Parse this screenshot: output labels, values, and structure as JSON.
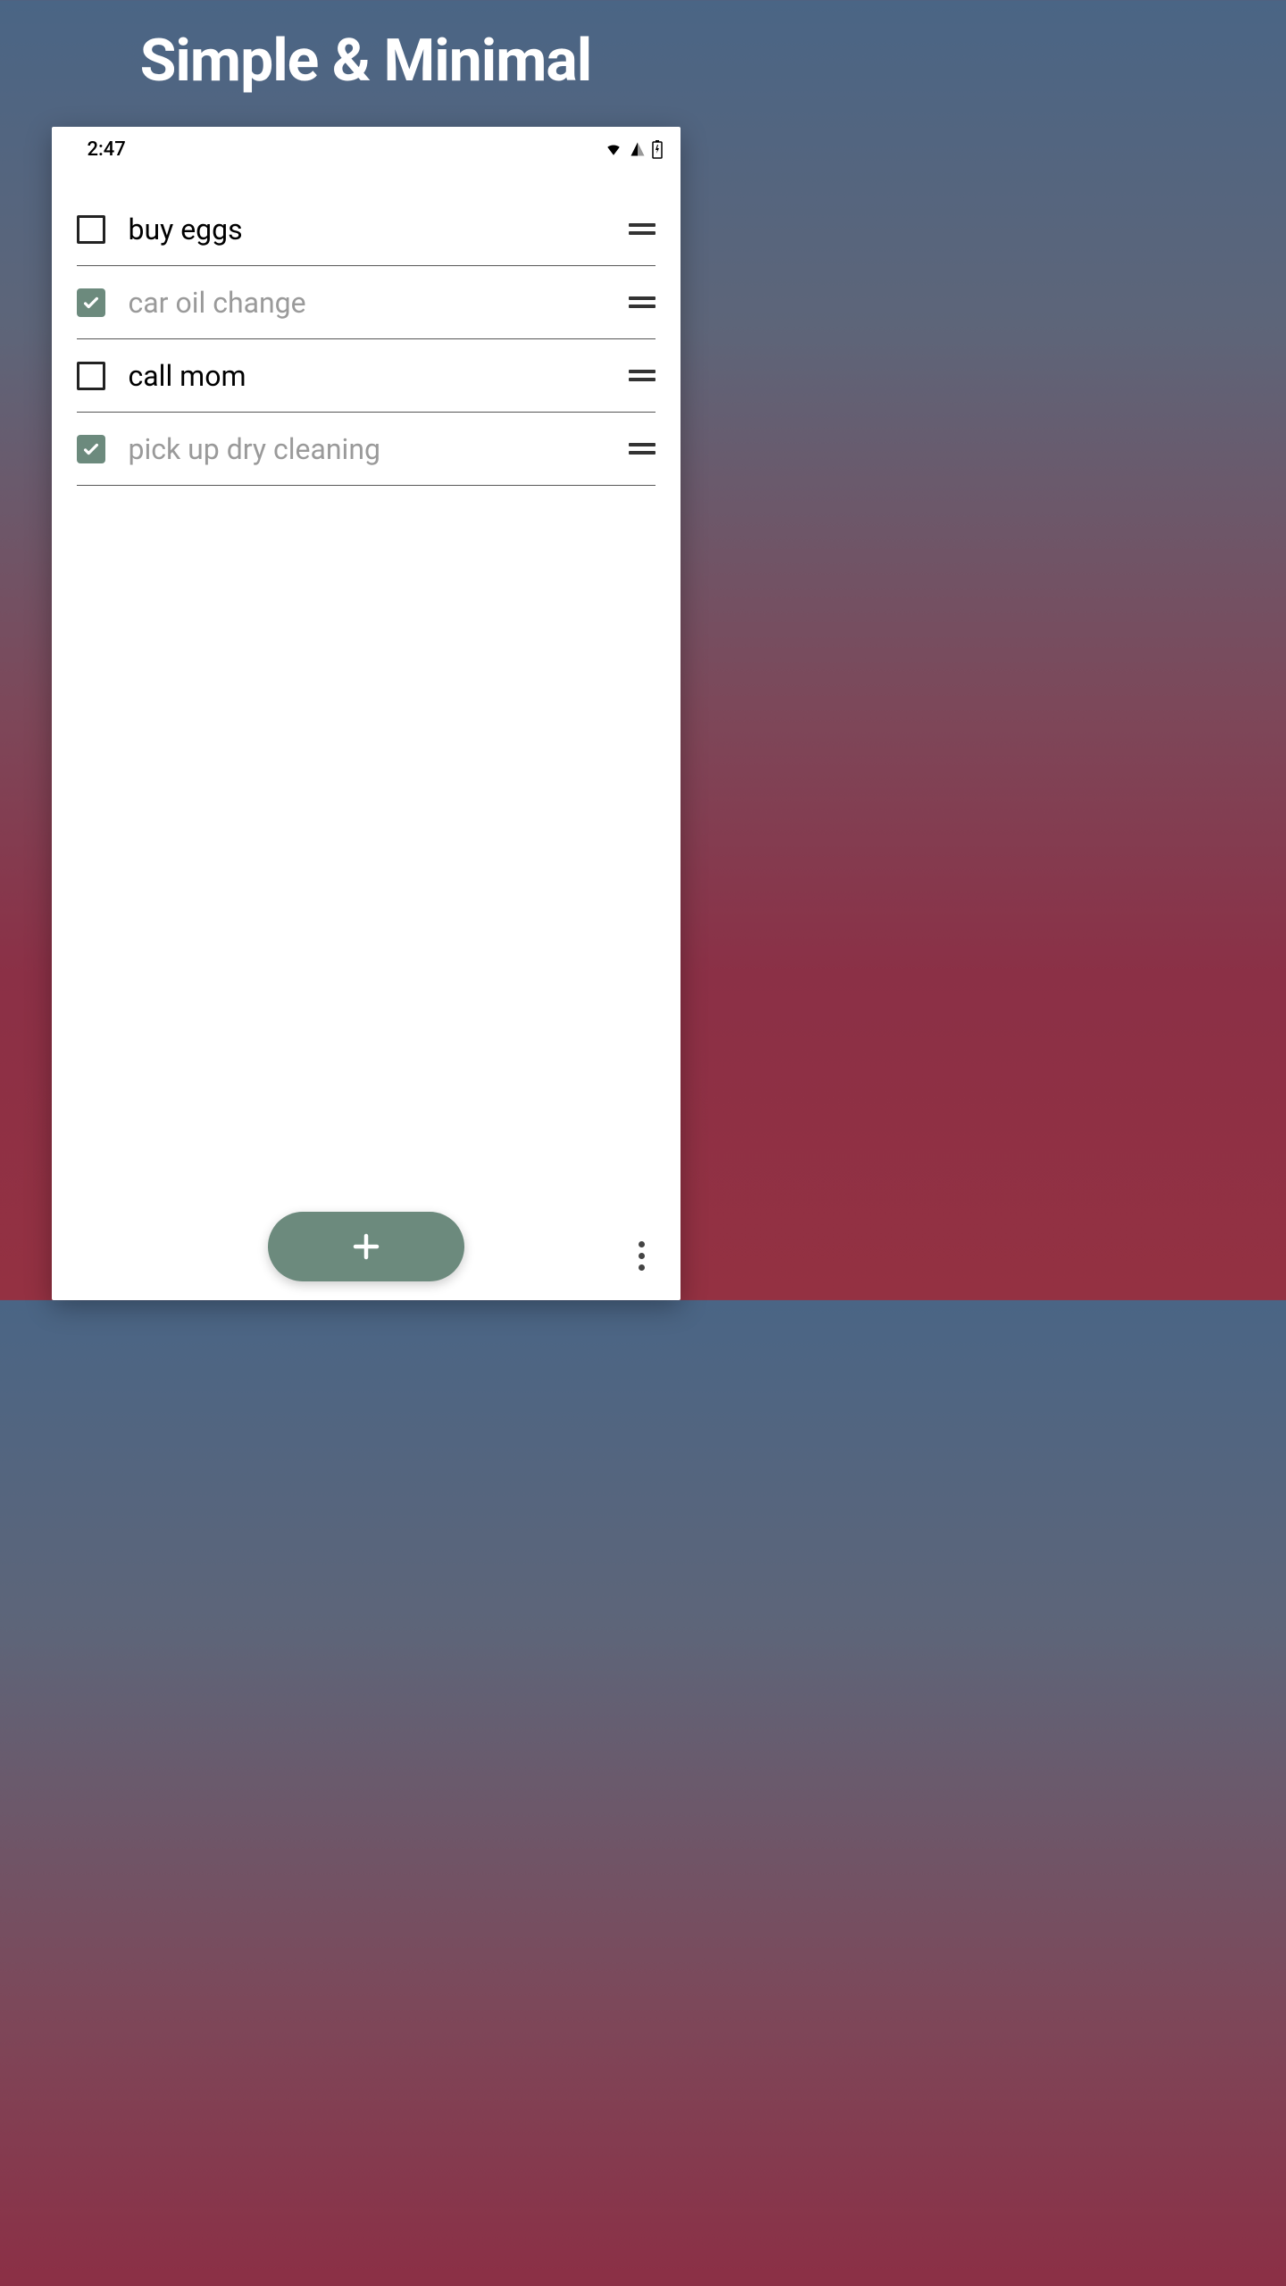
{
  "promo": {
    "title": "Simple & Minimal"
  },
  "status_bar": {
    "time": "2:47"
  },
  "tasks": [
    {
      "label": "buy eggs",
      "done": false
    },
    {
      "label": "car oil change",
      "done": true
    },
    {
      "label": "call mom",
      "done": false
    },
    {
      "label": "pick up dry cleaning",
      "done": true
    }
  ],
  "colors": {
    "accent": "#6c8a7d"
  }
}
